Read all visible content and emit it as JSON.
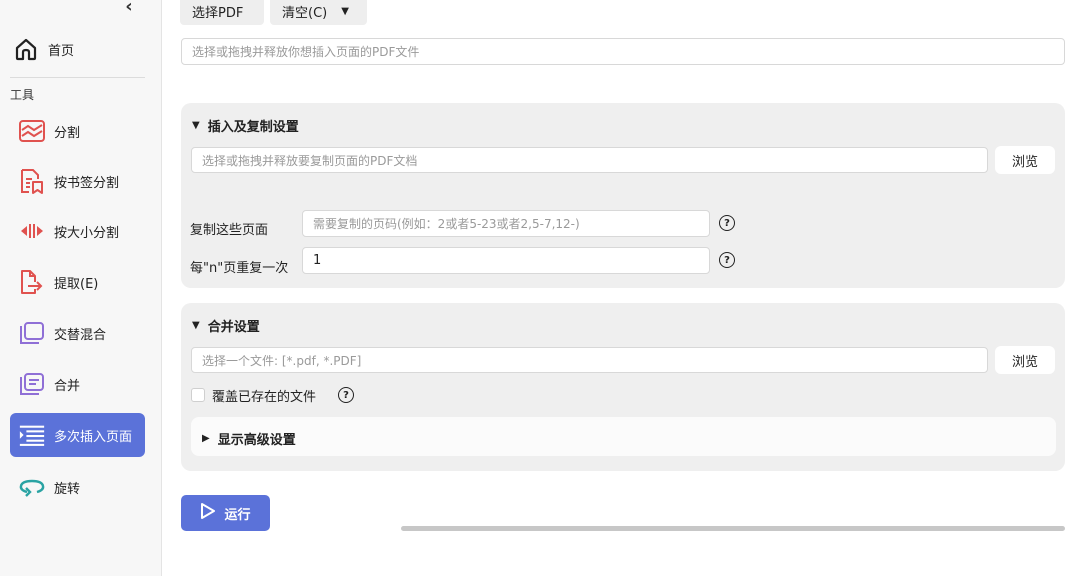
{
  "sidebar": {
    "collapse_symbol": "‹",
    "home_label": "首页",
    "section_label": "工具",
    "items": [
      {
        "label": "分割",
        "icon": "split-icon",
        "active": false
      },
      {
        "label": "按书签分割",
        "icon": "bookmark-split-icon",
        "active": false
      },
      {
        "label": "按大小分割",
        "icon": "size-split-icon",
        "active": false
      },
      {
        "label": "提取(E)",
        "icon": "extract-icon",
        "active": false
      },
      {
        "label": "交替混合",
        "icon": "alternate-mix-icon",
        "active": false
      },
      {
        "label": "合并",
        "icon": "merge-icon",
        "active": false
      },
      {
        "label": "多次插入页面",
        "icon": "multi-insert-icon",
        "active": true
      },
      {
        "label": "旋转",
        "icon": "rotate-icon",
        "active": false
      }
    ]
  },
  "toolbar": {
    "select_pdf_label": "选择PDF",
    "clear_label": "清空(C)"
  },
  "source_input": {
    "placeholder": "选择或拖拽并释放你想插入页面的PDF文件"
  },
  "insert_panel": {
    "title": "插入及复制设置",
    "file_placeholder": "选择或拖拽并释放要复制页面的PDF文档",
    "browse_label": "浏览",
    "pages_label": "复制这些页面",
    "pages_placeholder": "需要复制的页码(例如：2或者5-23或者2,5-7,12-)",
    "repeat_label": "每\"n\"页重复一次",
    "repeat_value": "1"
  },
  "merge_panel": {
    "title": "合并设置",
    "file_placeholder": "选择一个文件: [*.pdf, *.PDF]",
    "browse_label": "浏览",
    "overwrite_label": "覆盖已存在的文件",
    "overwrite_checked": false,
    "advanced_label": "显示高级设置"
  },
  "run_label": "运行",
  "colors": {
    "accent": "#5b72d9",
    "icon_red": "#e0524f",
    "icon_purple": "#8f6fd6",
    "icon_teal": "#2aa3a3"
  }
}
